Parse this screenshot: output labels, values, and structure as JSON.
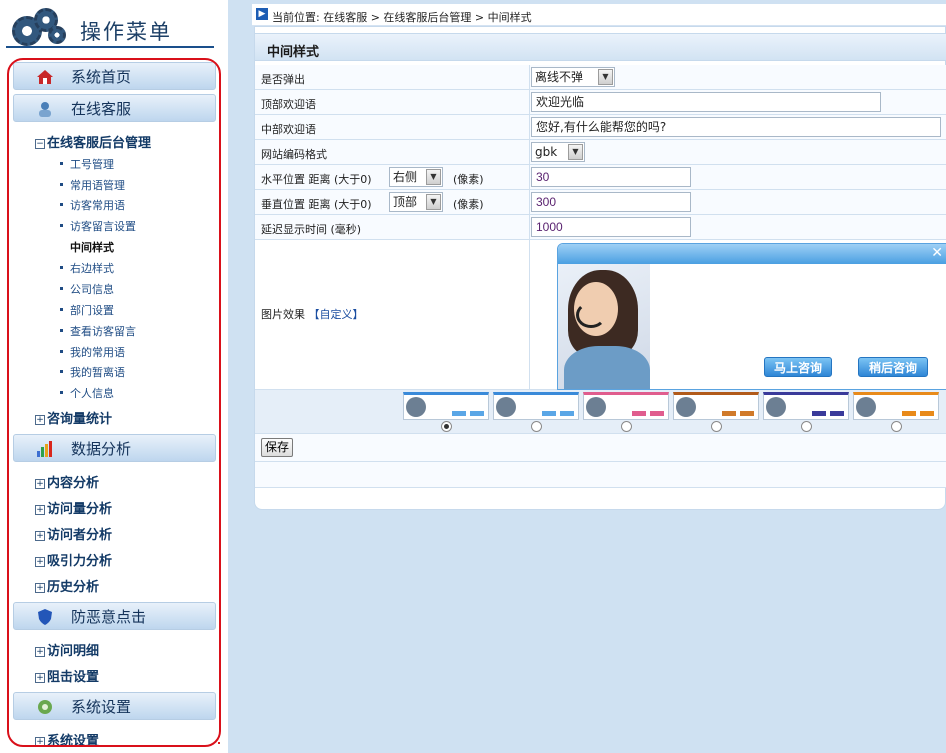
{
  "sidebar": {
    "title": "操作菜单",
    "sections": [
      {
        "label": "系统首页"
      },
      {
        "label": "在线客服"
      },
      {
        "label": "数据分析"
      },
      {
        "label": "防恶意点击"
      },
      {
        "label": "系统设置"
      }
    ],
    "online_service": {
      "tree_label": "在线客服后台管理",
      "items": [
        "工号管理",
        "常用语管理",
        "访客常用语",
        "访客留言设置",
        "中间样式",
        "右边样式",
        "公司信息",
        "部门设置",
        "查看访客留言",
        "我的常用语",
        "我的暂离语",
        "个人信息"
      ],
      "active_item": "中间样式",
      "stats_label": "咨询量统计"
    },
    "data_analysis": [
      "内容分析",
      "访问量分析",
      "访问者分析",
      "吸引力分析",
      "历史分析"
    ],
    "anti_click": [
      "访问明细",
      "阻击设置"
    ],
    "system_settings": [
      "系统设置"
    ]
  },
  "breadcrumb": "当前位置: 在线客服 > 在线客服后台管理 > 中间样式",
  "panel": {
    "title": "中间样式",
    "rows": {
      "popup_label": "是否弹出",
      "popup_value": "离线不弹",
      "top_greeting_label": "顶部欢迎语",
      "top_greeting_value": "欢迎光临",
      "middle_greeting_label": "中部欢迎语",
      "middle_greeting_value": "您好,有什么能帮您的吗?",
      "encoding_label": "网站编码格式",
      "encoding_value": "gbk",
      "horizontal_label": "水平位置 距离 (大于0)",
      "horizontal_side": "右侧",
      "horizontal_unit": "(像素)",
      "horizontal_value": "30",
      "vertical_label": "垂直位置 距离 (大于0)",
      "vertical_side": "顶部",
      "vertical_unit": "(像素)",
      "vertical_value": "300",
      "delay_label": "延迟显示时间 (毫秒)",
      "delay_value": "1000",
      "image_effect_label": "图片效果",
      "image_effect_link": "【自定义】"
    },
    "preview": {
      "close_glyph": "✕",
      "button_consult": "马上咨询",
      "button_later": "稍后咨询"
    },
    "thumbnail_count": 6,
    "selected_thumbnail": 1,
    "save_label": "保存"
  },
  "colors": {
    "sidebar_frame": "#d9101a",
    "accent_blue": "#1d5db4",
    "main_bg": "#cfe1f2"
  }
}
